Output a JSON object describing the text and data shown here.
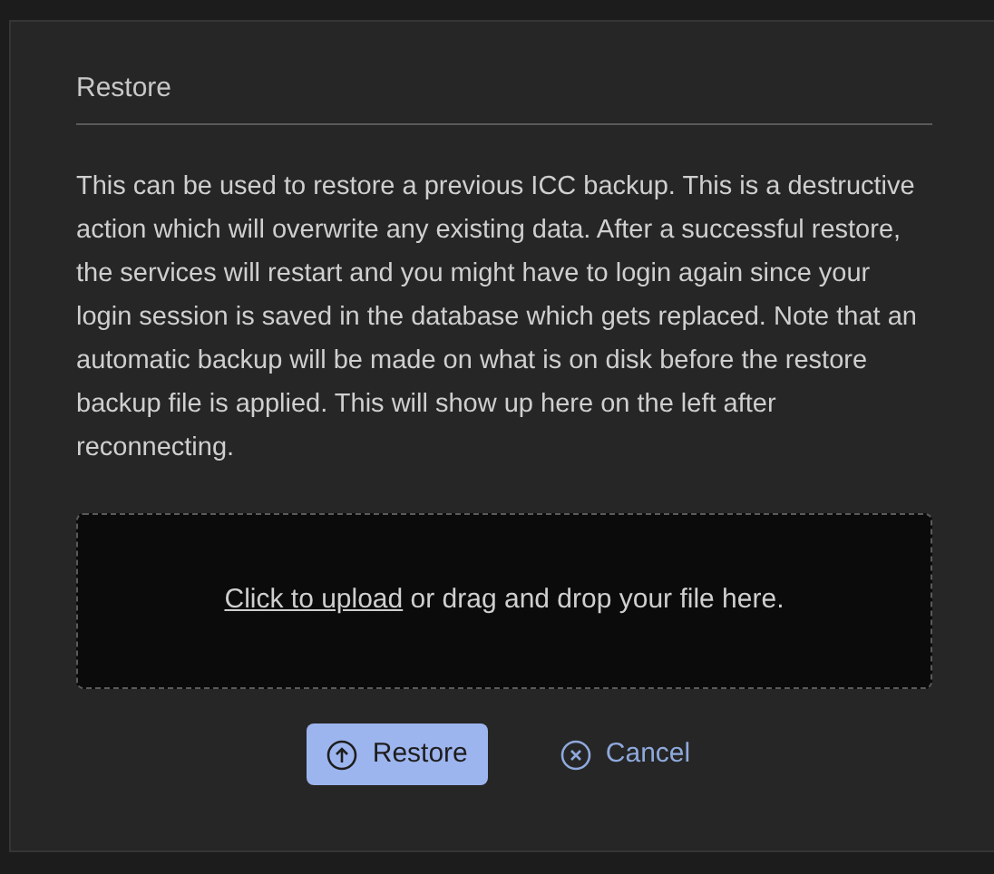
{
  "section": {
    "title": "Restore"
  },
  "description": "This can be used to restore a previous ICC backup. This is a destructive action which will overwrite any existing data. After a successful restore, the services will restart and you might have to login again since your login session is saved in the database which gets replaced. Note that an automatic backup will be made on what is on disk before the restore backup file is applied. This will show up here on the left after reconnecting.",
  "upload": {
    "link": "Click to upload",
    "text": "or drag and drop your file here."
  },
  "buttons": [
    {
      "label": "Restore",
      "kind": "primary"
    },
    {
      "label": "Cancel",
      "kind": "secondary"
    }
  ]
}
